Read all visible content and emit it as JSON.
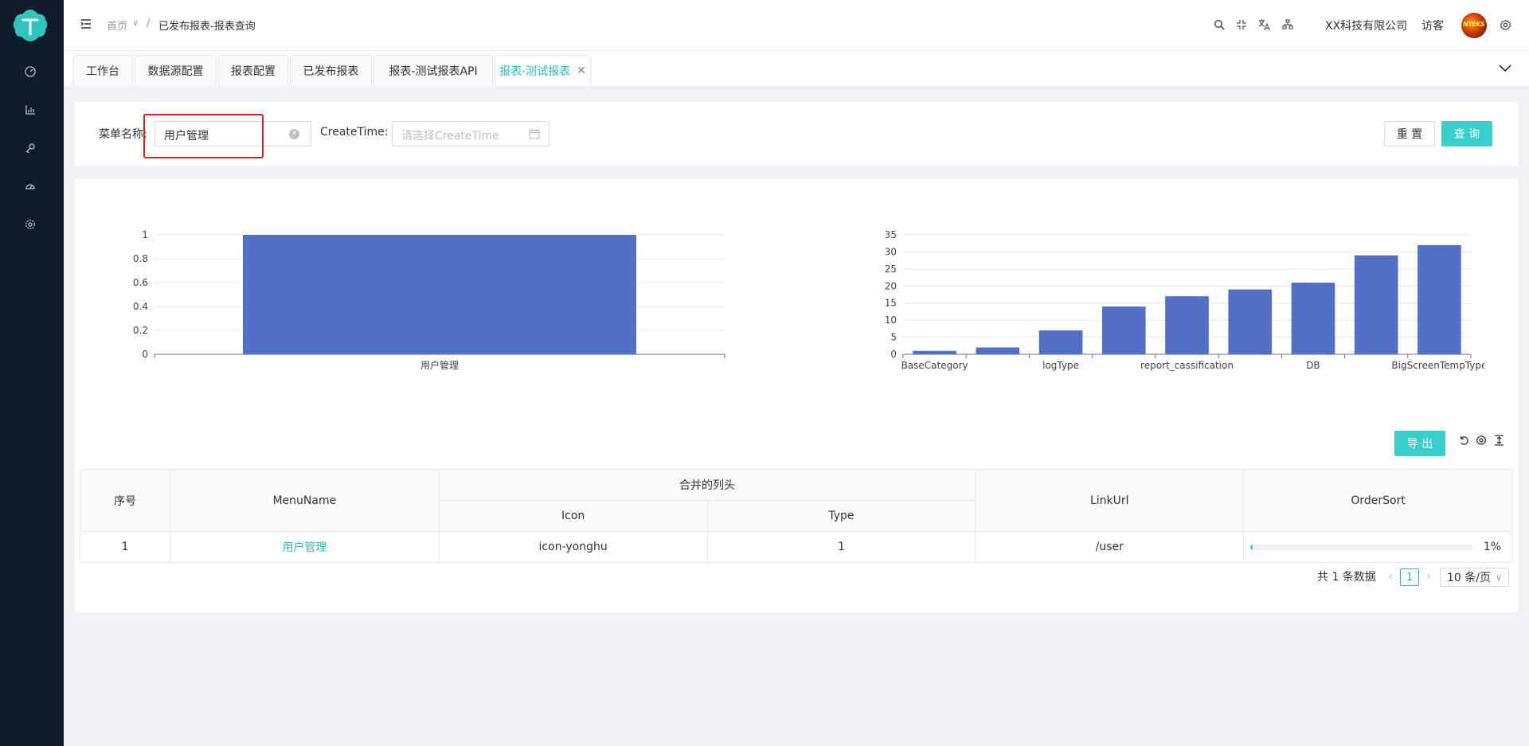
{
  "header": {
    "breadcrumb": [
      "首页",
      "已发布报表-报表查询"
    ],
    "company": "XX科技有限公司",
    "user": "访客"
  },
  "tabs": [
    {
      "label": "工作台"
    },
    {
      "label": "数据源配置"
    },
    {
      "label": "报表配置"
    },
    {
      "label": "已发布报表"
    },
    {
      "label": "报表-测试报表API"
    },
    {
      "label": "报表-测试报表",
      "active": true
    }
  ],
  "search": {
    "menu_name_label": "菜单名称:",
    "menu_name_value": "用户管理",
    "createtime_label": "CreateTime:",
    "createtime_placeholder": "请选择CreateTime",
    "reset_label": "重 置",
    "query_label": "查 询"
  },
  "chart_data": [
    {
      "type": "bar",
      "categories": [
        "用户管理"
      ],
      "values": [
        1
      ],
      "ylim": [
        0,
        1
      ],
      "yticks": [
        "0",
        "0.2",
        "0.4",
        "0.6",
        "0.8",
        "1"
      ],
      "grid": true
    },
    {
      "type": "bar",
      "categories": [
        "BaseCategory",
        "",
        "logType",
        "",
        "report_cassification",
        "",
        "DB",
        "",
        "BigScreenTempType"
      ],
      "values": [
        1,
        2,
        7,
        14,
        17,
        19,
        21,
        29,
        32
      ],
      "ylim": [
        0,
        35
      ],
      "yticks": [
        "0",
        "5",
        "10",
        "15",
        "20",
        "25",
        "30",
        "35"
      ],
      "grid": true
    }
  ],
  "toolbar": {
    "export_label": "导 出"
  },
  "table": {
    "headers": {
      "index": "序号",
      "menu_name": "MenuName",
      "merged": "合并的列头",
      "icon": "Icon",
      "type": "Type",
      "link_url": "LinkUrl",
      "order_sort": "OrderSort"
    },
    "rows": [
      {
        "index": "1",
        "menu_name": "用户管理",
        "icon": "icon-yonghu",
        "type": "1",
        "link_url": "/user",
        "order_sort": "1%",
        "order_sort_value": 0.01
      }
    ]
  },
  "pagination": {
    "total": "共 1 条数据",
    "current_page": "1",
    "page_size": "10 条/页"
  },
  "colors": {
    "accent": "#36cfc9",
    "bar": "#5470c6",
    "sidebar": "#0d1b2a"
  }
}
